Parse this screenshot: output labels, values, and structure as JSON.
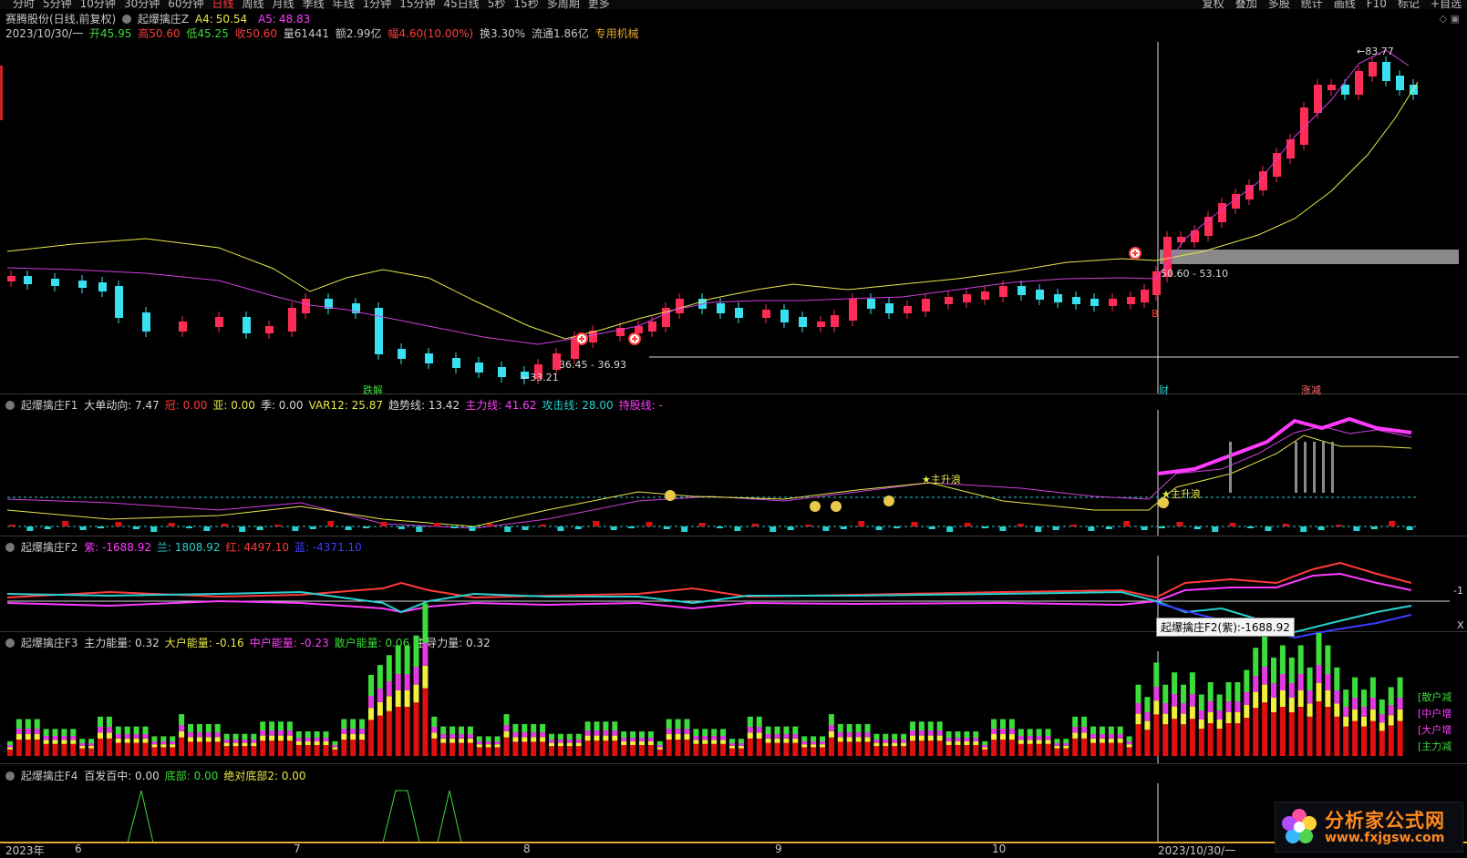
{
  "topbar": {
    "tabs": [
      "分时",
      "5分钟",
      "10分钟",
      "30分钟",
      "60分钟",
      "日线",
      "周线",
      "月线",
      "季线",
      "年线",
      "1分钟",
      "15分钟",
      "45日线",
      "5秒",
      "15秒",
      "多周期",
      "更多"
    ],
    "active_tab": "日线",
    "right": [
      "复权",
      "叠加",
      "多股",
      "统计",
      "画线",
      "F10",
      "标记",
      "+自选"
    ]
  },
  "main": {
    "stock": "赛腾股份(日线,前复权)",
    "indicator": "起爆擒庄Z",
    "a4_label": "A4:",
    "a4_value": "50.54",
    "a5_label": "A5:",
    "a5_value": "48.83",
    "date": "2023/10/30/一",
    "open": "开45.95",
    "high": "高50.60",
    "low": "低45.25",
    "close": "收50.60",
    "volume": "量61441",
    "amount": "额2.99亿",
    "change": "幅4.60(10.00%)",
    "turnover": "换3.30%",
    "float": "流通1.86亿",
    "sector": "专用机械",
    "high_label": "83.77",
    "low_label": "33.21",
    "range1": "36.45 - 36.93",
    "range2": "50.60 - 53.10",
    "signal_die": "跌解",
    "signal_cai": "财",
    "signal_zhang": "涨减",
    "mark_b": "B"
  },
  "f1": {
    "name": "起爆擒庄F1",
    "items": [
      {
        "label": "大单动向: 7.47",
        "color": "#d8d8d8"
      },
      {
        "label": "冠: 0.00",
        "color": "#ff3b3b"
      },
      {
        "label": "亚: 0.00",
        "color": "#e8e84a"
      },
      {
        "label": "季: 0.00",
        "color": "#d8d8d8"
      },
      {
        "label": "VAR12: 25.87",
        "color": "#e8e84a"
      },
      {
        "label": "趋势线: 13.42",
        "color": "#d8d8d8"
      },
      {
        "label": "主力线: 41.62",
        "color": "#ff3bff"
      },
      {
        "label": "攻击线: 28.00",
        "color": "#2ad0d0"
      },
      {
        "label": "持股线: -",
        "color": "#ff3bff"
      }
    ],
    "wave1": "★主升浪",
    "wave2": "★主升浪"
  },
  "f2": {
    "name": "起爆擒庄F2",
    "items": [
      {
        "label": "紫: -1688.92",
        "color": "#ff3bff"
      },
      {
        "label": "兰: 1808.92",
        "color": "#2ad0d0"
      },
      {
        "label": "红: 4497.10",
        "color": "#ff3b3b"
      },
      {
        "label": "蓝: -4371.10",
        "color": "#3b3bff"
      }
    ],
    "tooltip": "起爆擒庄F2(紫):-1688.92",
    "axis_right": "-1",
    "axis_x": "X"
  },
  "f3": {
    "name": "起爆擒庄F3",
    "items": [
      {
        "label": "主力能量: 0.32",
        "color": "#d8d8d8"
      },
      {
        "label": "大户能量: -0.16",
        "color": "#e8e84a"
      },
      {
        "label": "中户能量: -0.23",
        "color": "#ff3bff"
      },
      {
        "label": "散户能量: 0.06",
        "color": "#3bdc3b"
      },
      {
        "label": "主导力量: 0.32",
        "color": "#d8d8d8"
      }
    ],
    "side": [
      {
        "label": "散户减",
        "color": "#3bdc3b"
      },
      {
        "label": "中户增",
        "color": "#ff3bff"
      },
      {
        "label": "大户增",
        "color": "#ff3bff"
      },
      {
        "label": "主力减",
        "color": "#3bdc3b"
      }
    ]
  },
  "f4": {
    "name": "起爆擒庄F4",
    "items": [
      {
        "label": "百发百中: 0.00",
        "color": "#d8d8d8"
      },
      {
        "label": "底部: 0.00",
        "color": "#3bdc3b"
      },
      {
        "label": "绝对底部2: 0.00",
        "color": "#e8e84a"
      }
    ]
  },
  "xaxis": [
    "2023年",
    "6",
    "7",
    "8",
    "9",
    "10",
    "2023/10/30/一"
  ],
  "watermark": {
    "title": "分析家公式网",
    "url": "www.fxjgsw.com"
  },
  "colors": {
    "up": "#ff2d55",
    "down": "#39e0f0",
    "ma_yellow": "#e8e84a",
    "ma_purple": "#d040e0"
  }
}
